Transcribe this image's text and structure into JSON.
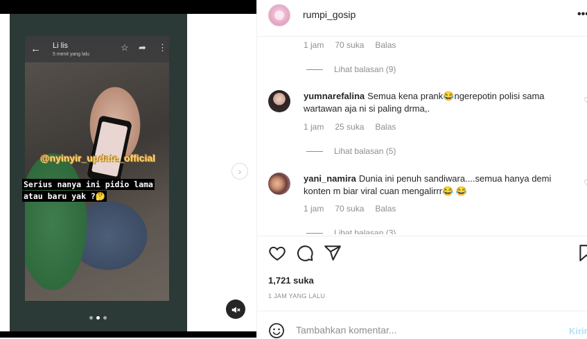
{
  "media": {
    "story": {
      "sender_name": "Li lis",
      "sent_time": "5 menit yang lalu",
      "watermark": "@nyinyir_update_official",
      "caption_line1": "Serius nanya ini pidio lama",
      "caption_line2": "atau baru yak ?🤔"
    },
    "carousel_dots": 3,
    "carousel_active": 1,
    "icons": {
      "back": "arrow-back-icon",
      "star": "star-icon",
      "share": "share-icon",
      "more": "more-vertical-icon",
      "next": "chevron-right-icon",
      "mute": "speaker-muted-icon"
    }
  },
  "post": {
    "username": "rumpi_gosip",
    "more_label": "•••"
  },
  "comments": {
    "prev_meta": {
      "time": "1 jam",
      "likes": "70 suka",
      "reply": "Balas"
    },
    "prev_view_replies": "Lihat balasan (9)",
    "items": [
      {
        "username": "yumnarefalina",
        "text": "Semua kena prank😂ngerepotin polisi sama wartawan aja ni si paling drma,.",
        "time": "1 jam",
        "likes": "25 suka",
        "reply": "Balas",
        "view_replies": "Lihat balasan (5)"
      },
      {
        "username": "yani_namira",
        "text": "Dunia ini penuh sandiwara....semua hanya demi konten m biar viral cuan mengalirrr😂 😂",
        "time": "1 jam",
        "likes": "70 suka",
        "reply": "Balas",
        "view_replies": "Lihat balasan (3)"
      }
    ]
  },
  "footer": {
    "likes_count": "1,721 suka",
    "timestamp": "1 JAM YANG LALU",
    "comment_placeholder": "Tambahkan komentar...",
    "post_label": "Kirim"
  },
  "colors": {
    "text_primary": "#262626",
    "text_secondary": "#8e8e8e",
    "post_disabled": "#b2dffc",
    "divider": "#efefef"
  }
}
